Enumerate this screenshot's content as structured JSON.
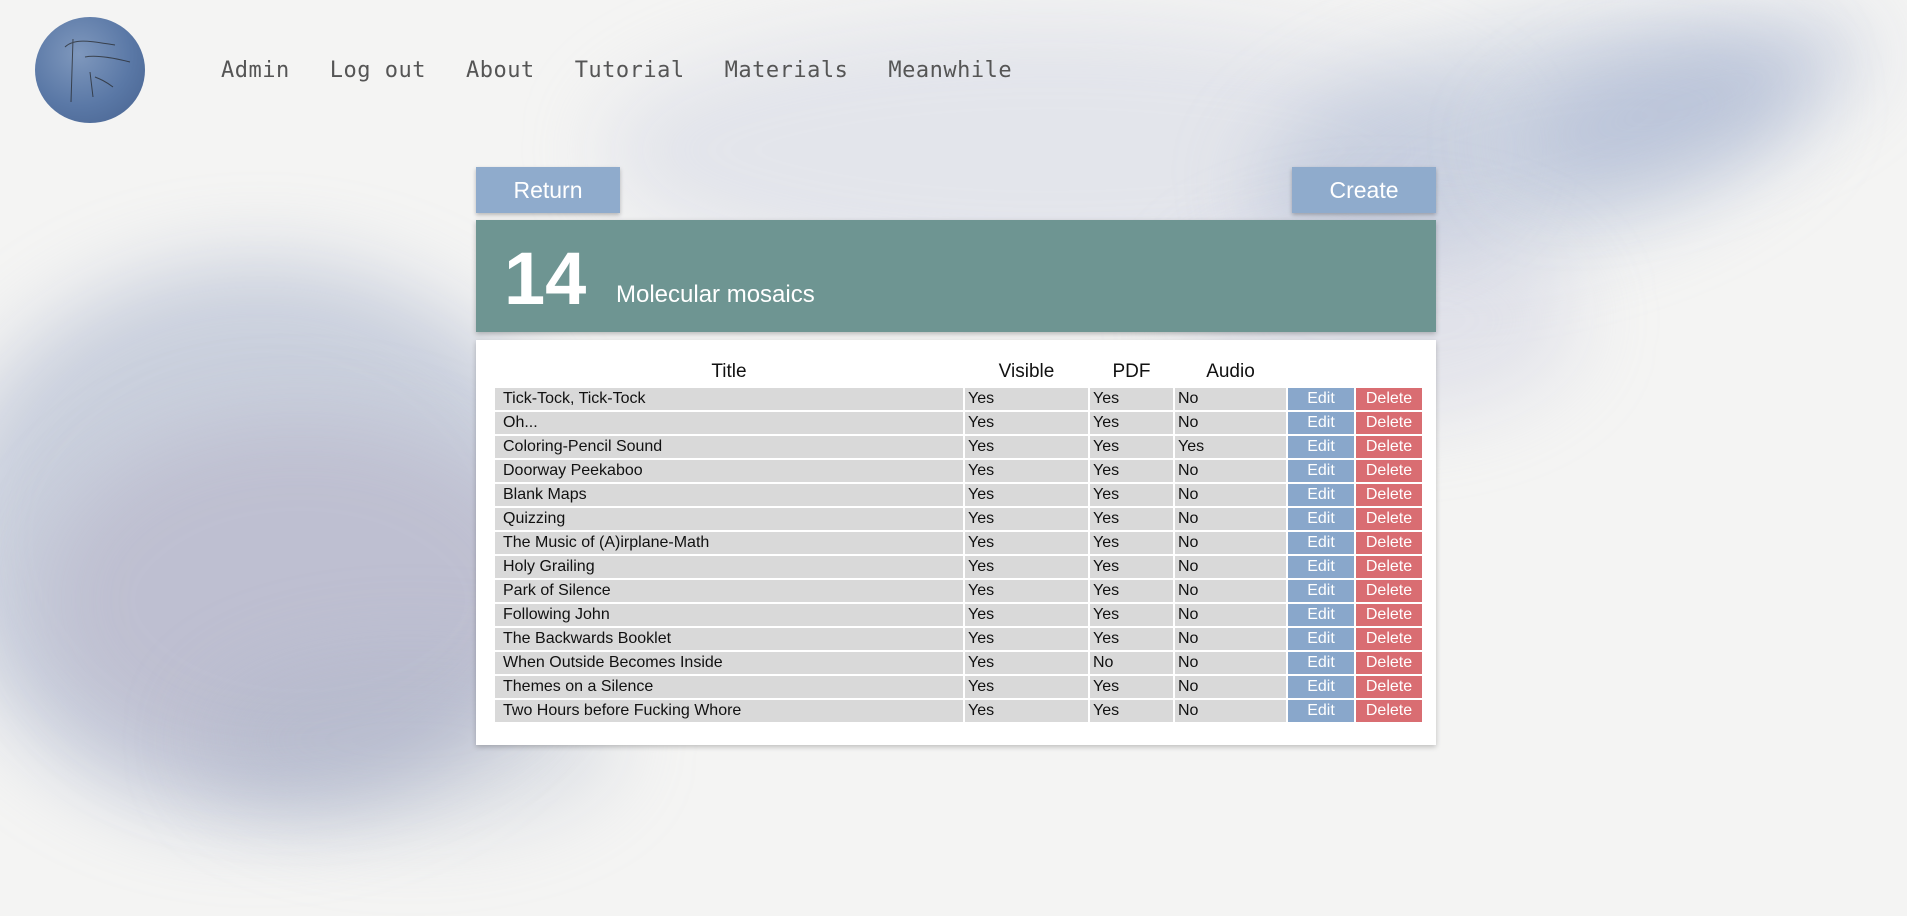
{
  "nav": {
    "items": [
      "Admin",
      "Log out",
      "About",
      "Tutorial",
      "Materials",
      "Meanwhile"
    ]
  },
  "logo": {
    "icon": "watercolor-circle-logo"
  },
  "actions": {
    "return_label": "Return",
    "create_label": "Create"
  },
  "collection": {
    "number": "14",
    "name": "Molecular mosaics",
    "color": "#6e9592"
  },
  "table": {
    "headers": {
      "title": "Title",
      "visible": "Visible",
      "pdf": "PDF",
      "audio": "Audio"
    },
    "edit_label": "Edit",
    "delete_label": "Delete",
    "rows": [
      {
        "title": "Tick-Tock, Tick-Tock",
        "visible": "Yes",
        "pdf": "Yes",
        "audio": "No"
      },
      {
        "title": "Oh...",
        "visible": "Yes",
        "pdf": "Yes",
        "audio": "No"
      },
      {
        "title": "Coloring-Pencil Sound",
        "visible": "Yes",
        "pdf": "Yes",
        "audio": "Yes"
      },
      {
        "title": "Doorway Peekaboo",
        "visible": "Yes",
        "pdf": "Yes",
        "audio": "No"
      },
      {
        "title": "Blank Maps",
        "visible": "Yes",
        "pdf": "Yes",
        "audio": "No"
      },
      {
        "title": "Quizzing",
        "visible": "Yes",
        "pdf": "Yes",
        "audio": "No"
      },
      {
        "title": "The Music of (A)irplane-Math",
        "visible": "Yes",
        "pdf": "Yes",
        "audio": "No"
      },
      {
        "title": "Holy Grailing",
        "visible": "Yes",
        "pdf": "Yes",
        "audio": "No"
      },
      {
        "title": "Park of Silence",
        "visible": "Yes",
        "pdf": "Yes",
        "audio": "No"
      },
      {
        "title": "Following John",
        "visible": "Yes",
        "pdf": "Yes",
        "audio": "No"
      },
      {
        "title": "The Backwards Booklet",
        "visible": "Yes",
        "pdf": "Yes",
        "audio": "No"
      },
      {
        "title": "When Outside Becomes Inside",
        "visible": "Yes",
        "pdf": "No",
        "audio": "No"
      },
      {
        "title": "Themes on a Silence",
        "visible": "Yes",
        "pdf": "Yes",
        "audio": "No"
      },
      {
        "title": "Two Hours before Fucking Whore",
        "visible": "Yes",
        "pdf": "Yes",
        "audio": "No"
      }
    ]
  },
  "colors": {
    "button_blue": "#8fabcc",
    "delete_red": "#d96d72",
    "banner_teal": "#6e9592"
  }
}
